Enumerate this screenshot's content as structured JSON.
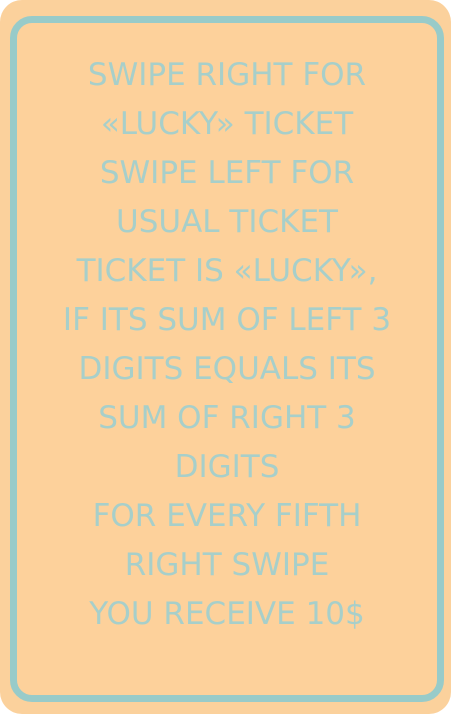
{
  "instructions": {
    "lines": [
      "SWIPE RIGHT FOR",
      "«LUCKY» TICKET",
      "SWIPE LEFT FOR",
      "USUAL TICKET",
      "TICKET IS «LUCKY»,",
      "IF ITS SUM OF LEFT 3",
      "DIGITS EQUALS ITS",
      "SUM OF RIGHT 3",
      "DIGITS",
      "FOR EVERY FIFTH",
      "RIGHT SWIPE",
      "YOU RECEIVE 10$"
    ]
  },
  "colors": {
    "card_background": "#fbd19c",
    "border": "#98cbc9",
    "text": "#a7cfca"
  }
}
